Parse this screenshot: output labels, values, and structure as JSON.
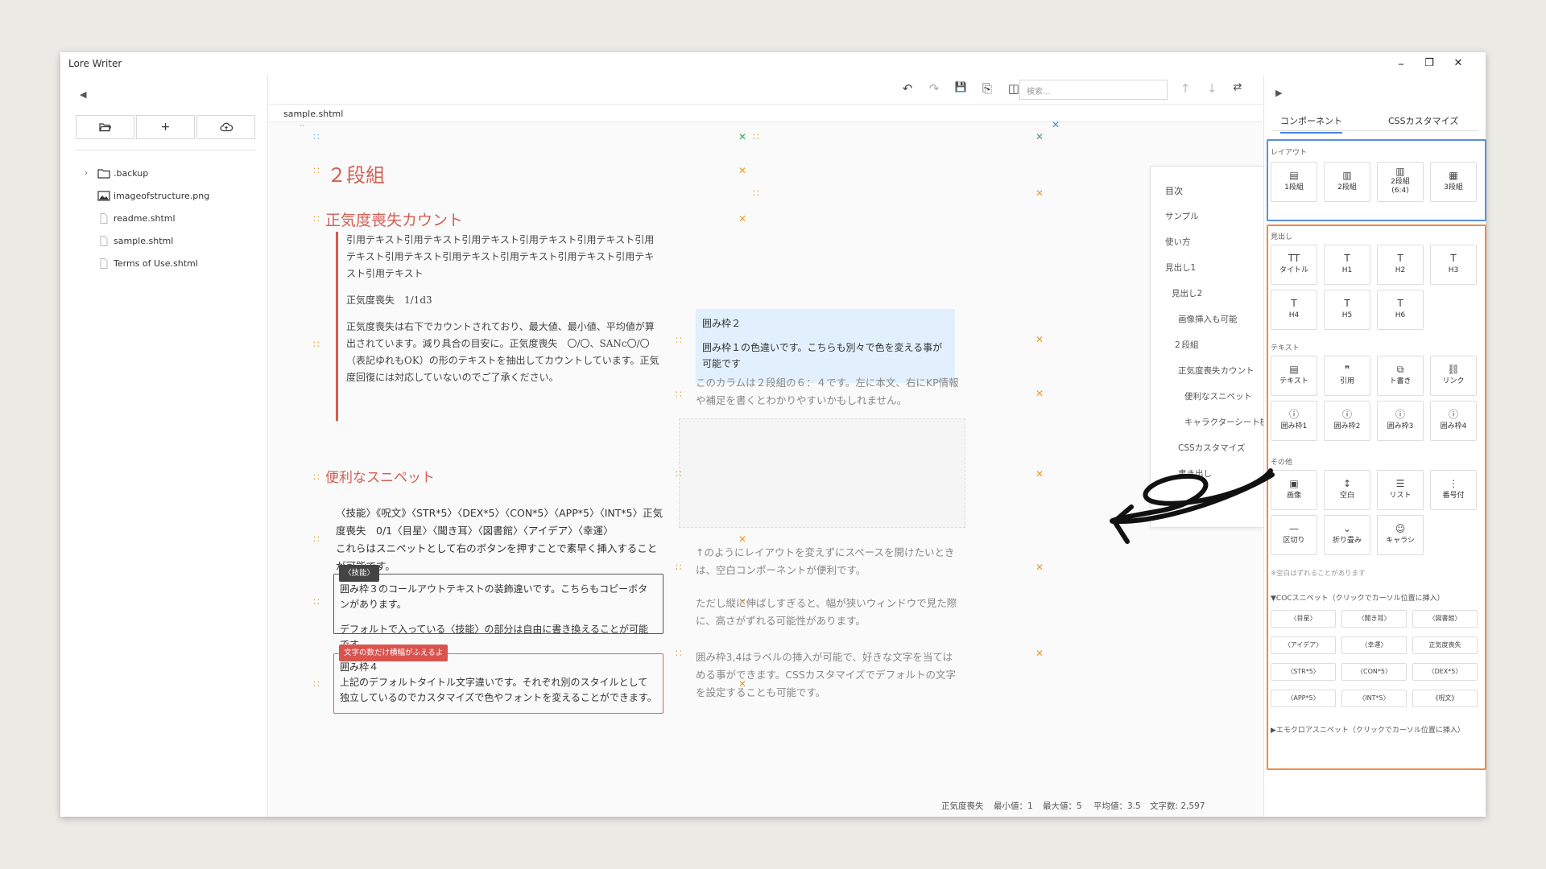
{
  "window": {
    "title": "Lore Writer",
    "min": "–",
    "max": "❐",
    "close": "✕"
  },
  "sidebar": {
    "collapse": "◀",
    "buttons": [
      {
        "name": "open-folder-icon",
        "glyph": "🗁"
      },
      {
        "name": "add-icon",
        "glyph": "+"
      },
      {
        "name": "cloud-upload-icon",
        "glyph": "☁"
      }
    ],
    "files": [
      {
        "label": ".backup",
        "type": "folder"
      },
      {
        "label": "imageofstructure.png",
        "type": "image"
      },
      {
        "label": "readme.shtml",
        "type": "file"
      },
      {
        "label": "sample.shtml",
        "type": "file"
      },
      {
        "label": "Terms of Use.shtml",
        "type": "file"
      }
    ]
  },
  "toolbar": {
    "undo": "↶",
    "redo": "↷",
    "save": "💾",
    "export": "⎘",
    "split": "◫",
    "theme": "☾",
    "search_placeholder": "検索...",
    "prev": "↑",
    "next": "↓",
    "replace": "⇄"
  },
  "file_tab": "sample.shtml",
  "editor": {
    "h1": "２段組",
    "h2_1": "正気度喪失カウント",
    "quote_p1": "引用テキスト引用テキスト引用テキスト引用テキスト引用テキスト引用テキスト引用テキスト引用テキスト引用テキスト引用テキスト引用テキスト引用テキスト",
    "quote_p2": "正気度喪失　1/1d3",
    "quote_p3": "正気度喪失は右下でカウントされており、最大値、最小値、平均値が算出されています。減り具合の目安に。正気度喪失　〇/〇、SANc〇/〇（表記ゆれもOK）の形のテキストを抽出してカウントしています。正気度回復には対応していないのでご了承ください。",
    "h2_2": "便利なスニペット",
    "snippet_line": "〈技能〉《呪文》〈STR*5〉〈DEX*5〉〈CON*5〉〈APP*5〉〈INT*5〉正気度喪失　0/1〈目星〉〈聞き耳〉〈図書館〉〈アイデア〉〈幸運〉",
    "snippet_desc": "これらはスニペットとして右のボタンを押すことで素早く挿入することが可能です。",
    "box3_label": "〈技能〉",
    "box3_p1": "囲み枠３のコールアウトテキストの装飾違いです。こちらもコピーボタンがあります。",
    "box3_p2": "デフォルトで入っている〈技能〉の部分は自由に書き換えることが可能です。",
    "box4_label": "文字の数だけ横幅がふえるよ",
    "box4_title": "囲み枠４",
    "box4_body": "上記のデフォルトタイトル文字違いです。それぞれ別のスタイルとして独立しているのでカスタマイズで色やフォントを変えることができます。",
    "box2_title": "囲み枠２",
    "box2_body": "囲み枠１の色違いです。こちらも別々で色を変える事が可能です",
    "col_note": "このカラムは２段組の６：４です。左に本文、右にKP情報や補足を書くとわかりやすいかもしれません。",
    "spacer_note": "↑のようにレイアウトを変えずにスペースを開けたいときは、空白コンポーネントが便利です。",
    "stretch_note": "ただし縦に伸ばしすぎると、幅が狭いウィンドウで見た際に、高さがずれる可能性があります。",
    "label_note": "囲み枠3,4はラベルの挿入が可能で、好きな文字を当てはめる事ができます。CSSカスタマイズでデフォルトの文字を設定することも可能です。"
  },
  "toc": {
    "title": "目次",
    "close": "✕",
    "items": [
      "サンプル",
      "使い方",
      "見出し1",
      "見出し2",
      "画像挿入も可能",
      "２段組",
      "正気度喪失カウント",
      "便利なスニペット",
      "キャラクターシート機能",
      "CSSカスタマイズ",
      "書き出し"
    ]
  },
  "status": {
    "san": "正気度喪失",
    "min": "最小値：1",
    "max": "最大値：5",
    "avg": "平均値：3.5",
    "chars": "文字数: 2,597"
  },
  "rpanel": {
    "collapse": "▶",
    "tabs": [
      "コンポーネント",
      "CSSカスタマイズ"
    ],
    "layout_title": "レイアウト",
    "layout": [
      {
        "icon": "▤",
        "label": "1段組"
      },
      {
        "icon": "▥",
        "label": "2段組"
      },
      {
        "icon": "▥",
        "label": "2段組\n(6:4)"
      },
      {
        "icon": "▦",
        "label": "3段組"
      }
    ],
    "heading_title": "見出し",
    "headings": [
      {
        "icon": "TT",
        "label": "タイトル"
      },
      {
        "icon": "T",
        "label": "H1"
      },
      {
        "icon": "T",
        "label": "H2"
      },
      {
        "icon": "T",
        "label": "H3"
      },
      {
        "icon": "T",
        "label": "H4"
      },
      {
        "icon": "T",
        "label": "H5"
      },
      {
        "icon": "T",
        "label": "H6"
      }
    ],
    "text_title": "テキスト",
    "texts": [
      {
        "icon": "▤",
        "label": "テキスト"
      },
      {
        "icon": "❞",
        "label": "引用"
      },
      {
        "icon": "⧉",
        "label": "ト書き"
      },
      {
        "icon": "⛓",
        "label": "リンク"
      },
      {
        "icon": "ⓘ",
        "label": "囲み枠1"
      },
      {
        "icon": "ⓘ",
        "label": "囲み枠2"
      },
      {
        "icon": "ⓘ",
        "label": "囲み枠3"
      },
      {
        "icon": "ⓘ",
        "label": "囲み枠4"
      }
    ],
    "other_title": "その他",
    "others": [
      {
        "icon": "▣",
        "label": "画像"
      },
      {
        "icon": "↕",
        "label": "空白"
      },
      {
        "icon": "☰",
        "label": "リスト"
      },
      {
        "icon": "⋮",
        "label": "番号付"
      },
      {
        "icon": "—",
        "label": "区切り"
      },
      {
        "icon": "⌄",
        "label": "折り畳み"
      },
      {
        "icon": "☺",
        "label": "キャラシ"
      }
    ],
    "spacer_note": "※空白はずれることがあります",
    "coc_title": "▼COCスニペット（クリックでカーソル位置に挿入）",
    "coc": [
      "〈目星〉",
      "〈聞き耳〉",
      "〈図書館〉",
      "〈アイデア〉",
      "〈幸運〉",
      "正気度喪失",
      "〈STR*5〉",
      "〈CON*5〉",
      "〈DEX*5〉",
      "〈APP*5〉",
      "〈INT*5〉",
      "《呪文》"
    ],
    "emo_title": "▶エモクロアスニペット（クリックでカーソル位置に挿入）"
  },
  "colors": {
    "accent_red": "#d15f55",
    "blue_outline": "#5b8fe0",
    "orange_outline": "#ef8a4a",
    "box2_bg": "#e1f0fc"
  }
}
